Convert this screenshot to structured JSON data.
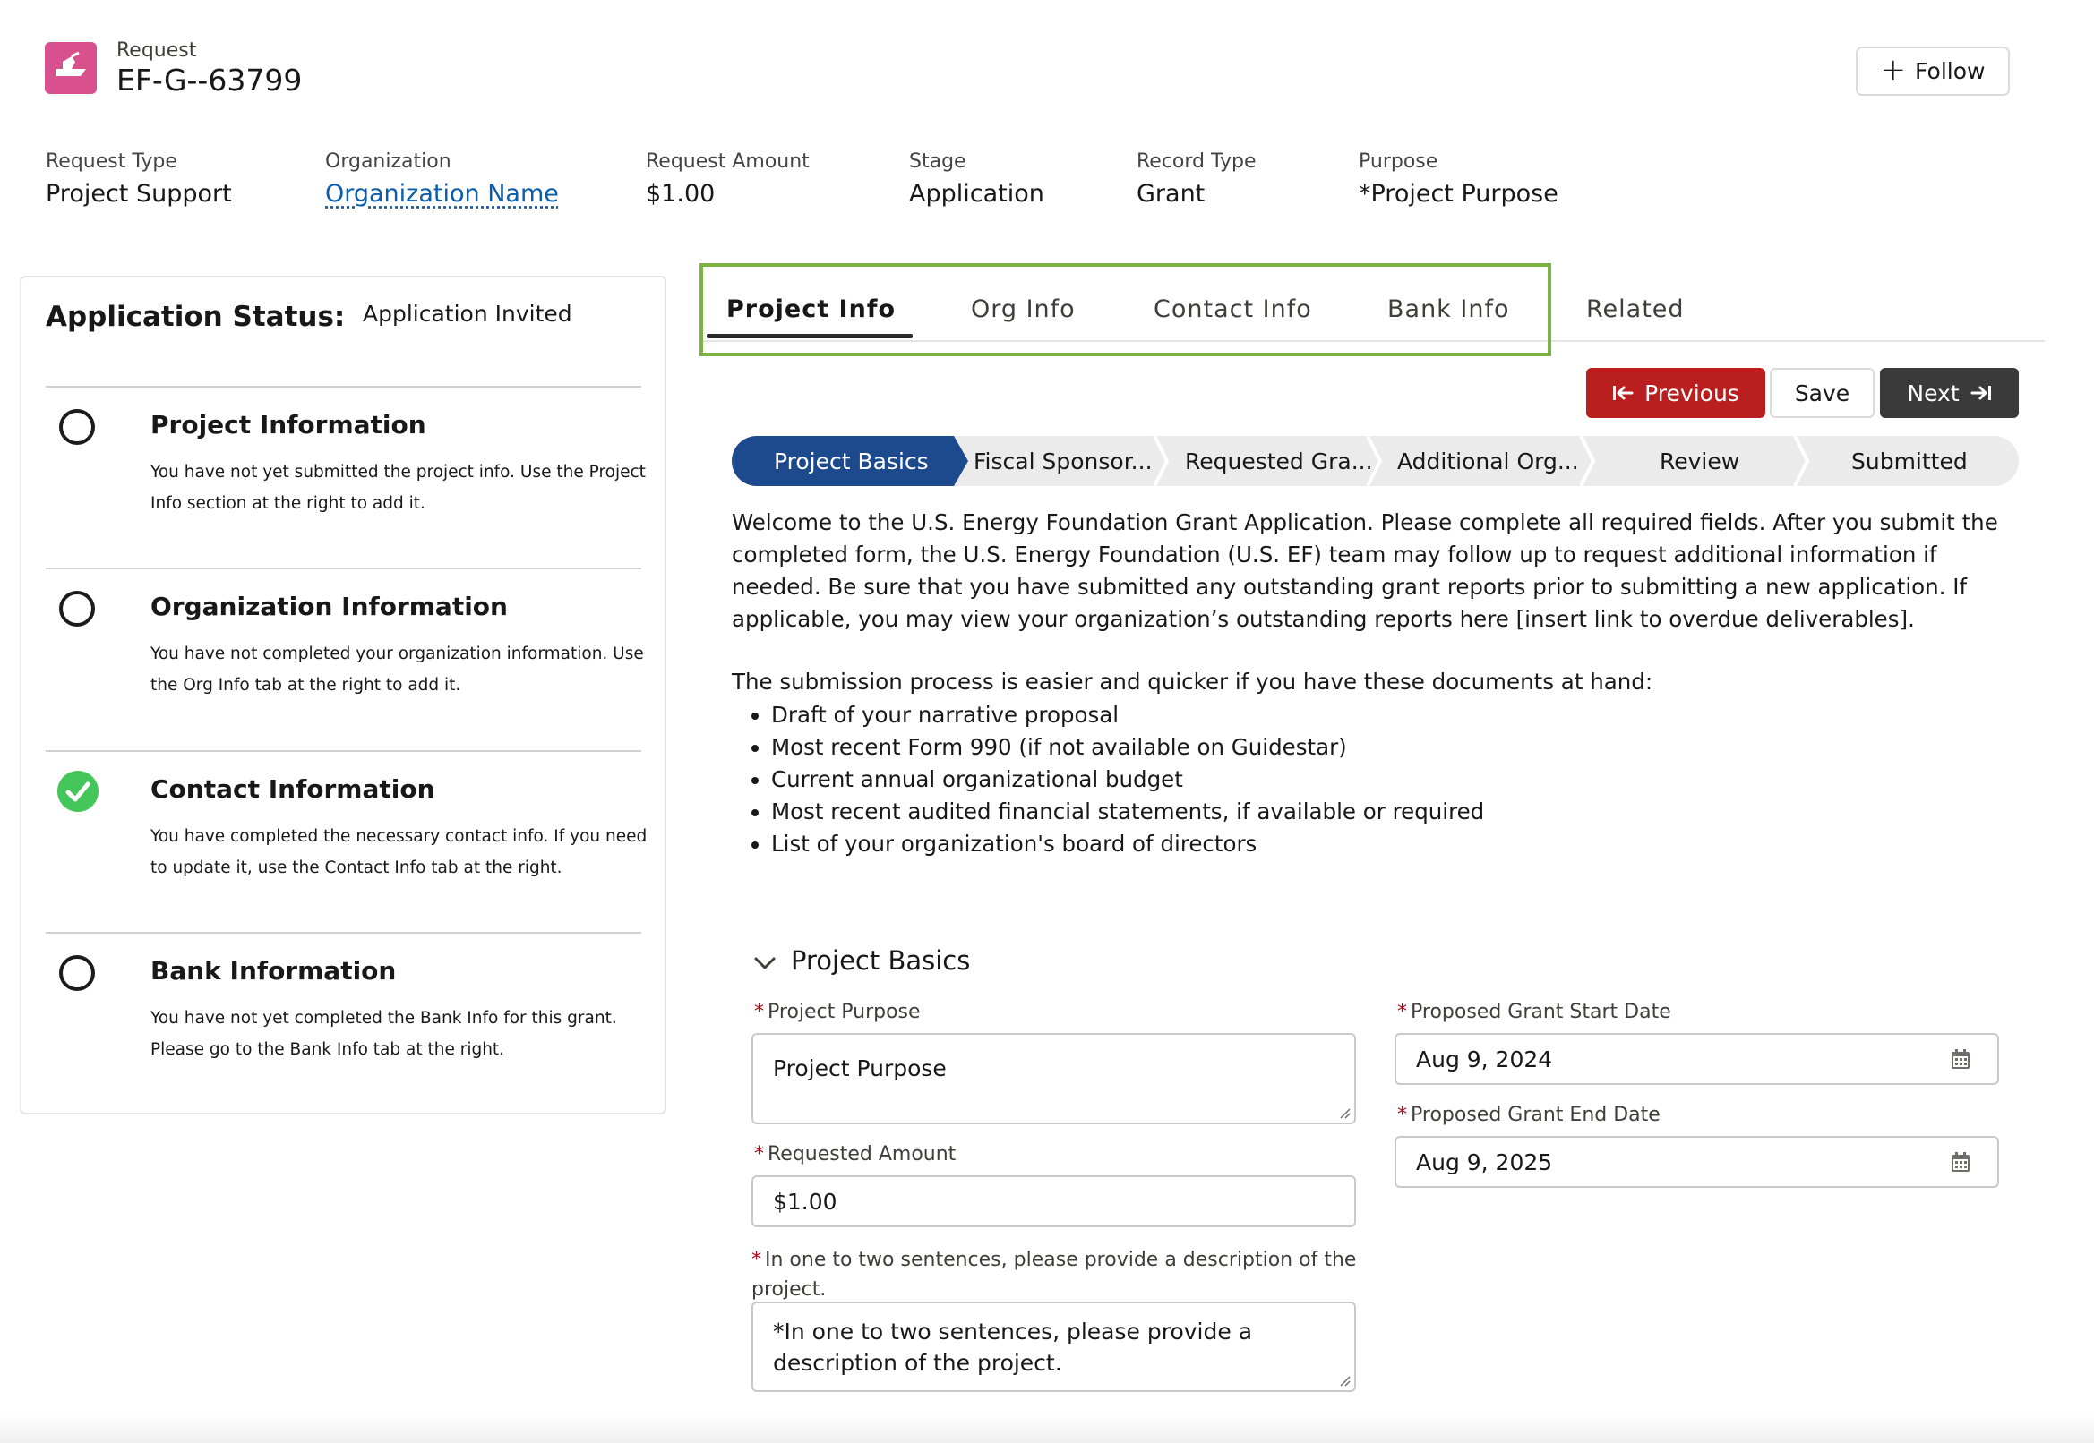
{
  "header": {
    "object_label": "Request",
    "record_name": "EF-G--63799",
    "follow_label": "Follow",
    "brand_color": "#d9508e"
  },
  "highlights": [
    {
      "label": "Request Type",
      "value": "Project Support"
    },
    {
      "label": "Organization",
      "value": "Organization Name"
    },
    {
      "label": "Request Amount",
      "value": "$1.00"
    },
    {
      "label": "Stage",
      "value": "Application"
    },
    {
      "label": "Record Type",
      "value": "Grant"
    },
    {
      "label": "Purpose",
      "value": "*Project Purpose"
    }
  ],
  "status_panel": {
    "label": "Application Status:",
    "value": "Application Invited",
    "sections": [
      {
        "title": "Project Information",
        "desc": "You have not yet submitted the project info. Use the Project Info section at the right to add it.",
        "complete": false
      },
      {
        "title": "Organization Information",
        "desc": "You have not completed your organization information. Use the Org Info tab at the right to add it.",
        "complete": false
      },
      {
        "title": "Contact Information",
        "desc": "You have completed the necessary contact info. If you need to update it, use the Contact Info tab at the right.",
        "complete": true
      },
      {
        "title": "Bank Information",
        "desc": "You have not yet completed the Bank Info for this grant. Please go to the Bank Info tab at the right.",
        "complete": false
      }
    ]
  },
  "tabs": [
    {
      "label": "Project Info",
      "active": true
    },
    {
      "label": "Org Info",
      "active": false
    },
    {
      "label": "Contact Info",
      "active": false
    },
    {
      "label": "Bank Info",
      "active": false
    },
    {
      "label": "Related",
      "active": false
    }
  ],
  "actions": {
    "previous": "Previous",
    "save": "Save",
    "next": "Next"
  },
  "path_steps": [
    {
      "label": "Project Basics",
      "active": true
    },
    {
      "label": "Fiscal Sponsor...",
      "active": false
    },
    {
      "label": "Requested Gra...",
      "active": false
    },
    {
      "label": "Additional Org...",
      "active": false
    },
    {
      "label": "Review",
      "active": false
    },
    {
      "label": "Submitted",
      "active": false
    }
  ],
  "intro": {
    "welcome": "Welcome to the U.S. Energy Foundation Grant Application. Please complete all required fields. After you submit the completed form, the U.S. Energy Foundation (U.S. EF) team may follow up to request additional information if needed. Be sure that you have submitted any outstanding grant reports prior to submitting a new application. If applicable, you may view your organization’s outstanding reports here [insert link to overdue deliverables].",
    "docs_heading": "The submission process is easier and quicker if you have these documents at hand:",
    "docs": [
      "Draft of your narrative proposal",
      "Most recent Form 990 (if not available on Guidestar)",
      "Current annual organizational budget",
      "Most recent audited financial statements, if available or required",
      "List of your organization's board of directors"
    ]
  },
  "section": {
    "title": "Project Basics",
    "fields": {
      "project_purpose": {
        "label": "Project Purpose",
        "value": "Project Purpose"
      },
      "requested_amount": {
        "label": "Requested Amount",
        "value": "$1.00"
      },
      "description": {
        "label": "In one to two sentences, please provide a description of the project.",
        "value": "*In one to two sentences, please provide a description of the project."
      },
      "start_date": {
        "label": "Proposed Grant Start Date",
        "value": "Aug 9, 2024"
      },
      "end_date": {
        "label": "Proposed Grant End Date",
        "value": "Aug 9, 2025"
      }
    }
  },
  "colors": {
    "previous_button": "#ba1f1f",
    "next_button": "#3a3a3a",
    "path_active": "#1c4a8c",
    "complete_check": "#45c65a",
    "tab_highlight": "#7cb342",
    "required_asterisk": "#ba0517",
    "link": "#0b5cab"
  }
}
